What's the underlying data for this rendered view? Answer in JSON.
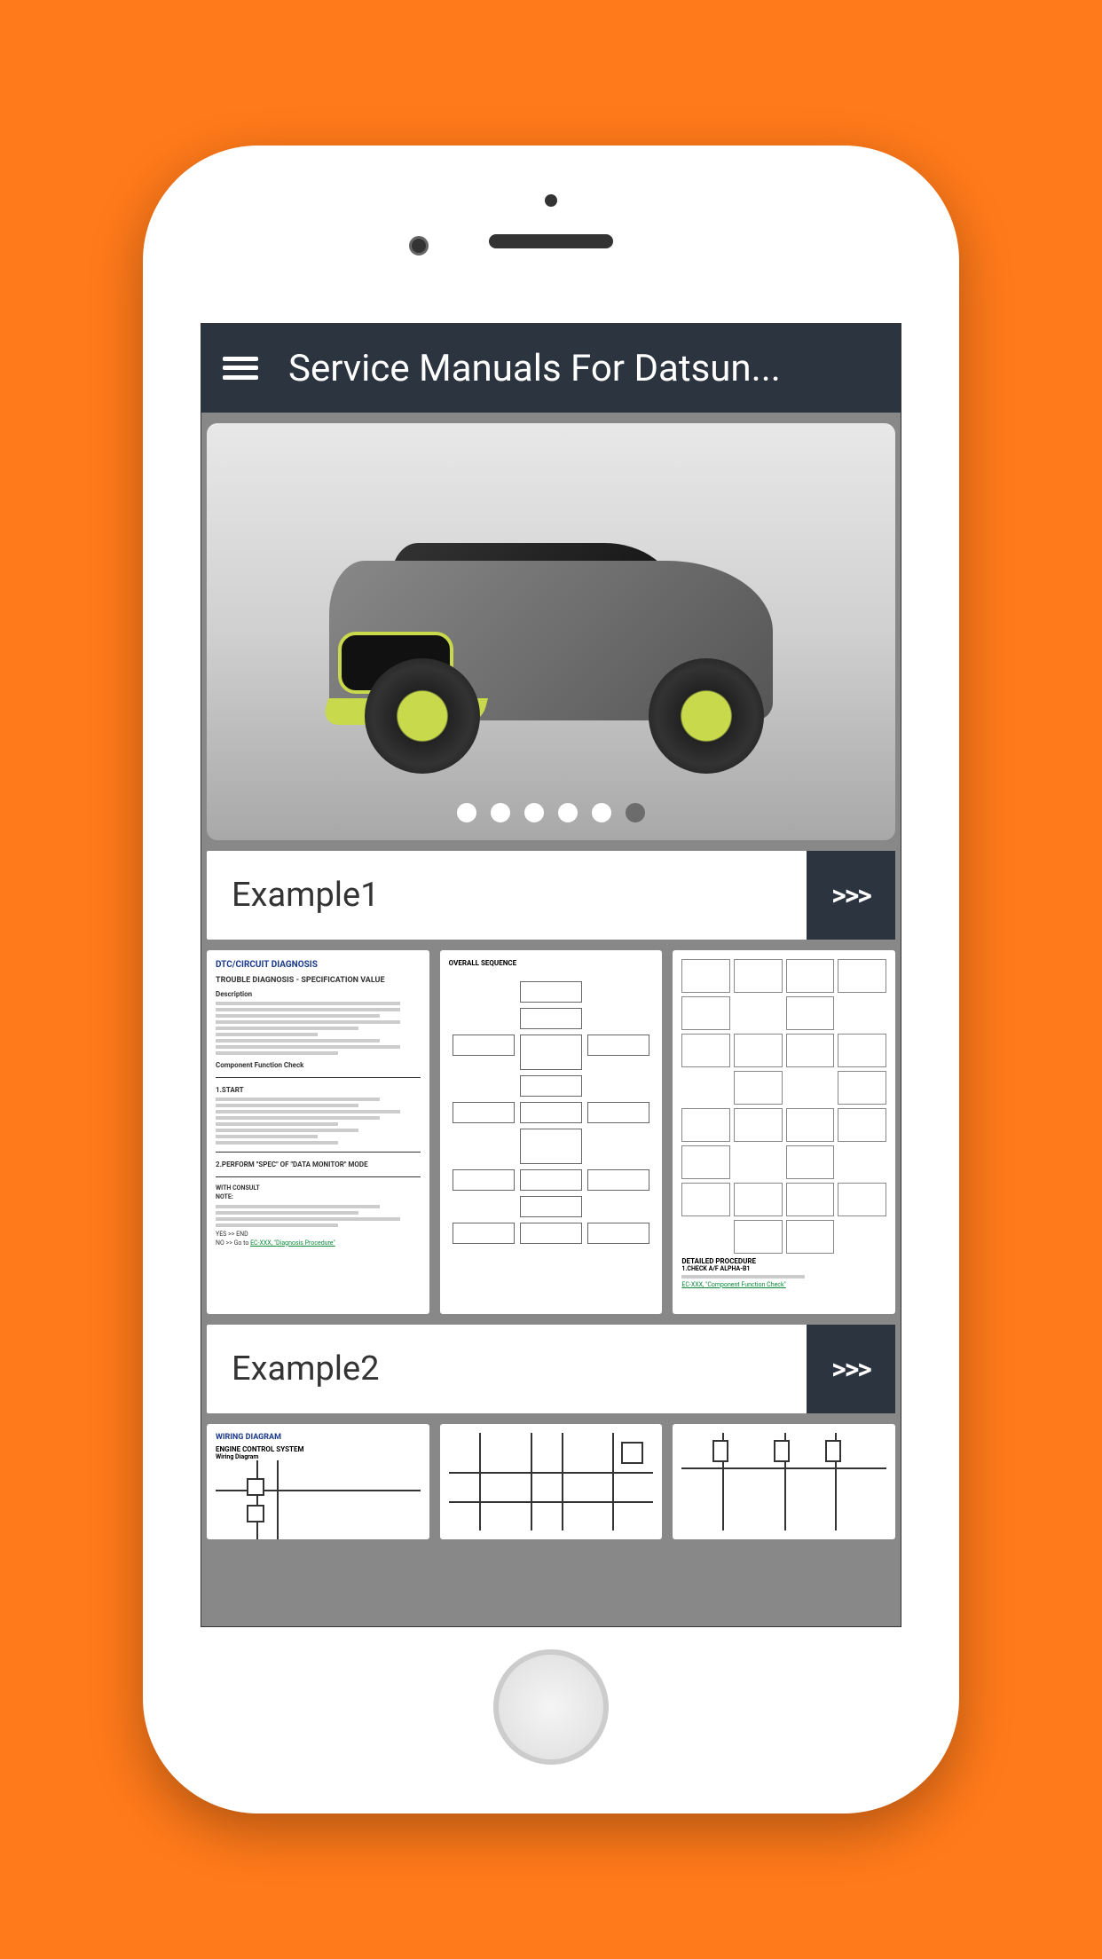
{
  "header": {
    "title": "Service Manuals For Datsun..."
  },
  "carousel": {
    "total_dots": 6,
    "active_index": 5
  },
  "sections": [
    {
      "title": "Example1",
      "more_label": ">>>",
      "thumbs": [
        {
          "type": "text-doc",
          "heading": "DTC/CIRCUIT DIAGNOSIS",
          "subheading": "TROUBLE DIAGNOSIS - SPECIFICATION VALUE",
          "section1": "Description",
          "section2": "Component Function Check",
          "step1": "1.START",
          "step2": "2.PERFORM \"SPEC\" OF \"DATA MONITOR\" MODE",
          "consult": "WITH CONSULT",
          "note": "NOTE:",
          "yes_end": "YES  >> END",
          "no_goto": "NO   >> Go to ",
          "link": "EC-XXX, \"Diagnosis Procedure\""
        },
        {
          "type": "flowchart",
          "heading": "OVERALL SEQUENCE"
        },
        {
          "type": "diagram",
          "footer1": "DETAILED PROCEDURE",
          "footer2": "1.CHECK A/F ALPHA-B1",
          "footer_link": "EC-XXX, \"Component Function Check\""
        }
      ]
    },
    {
      "title": "Example2",
      "more_label": ">>>",
      "thumbs": [
        {
          "type": "wiring",
          "heading": "WIRING DIAGRAM",
          "subheading": "ENGINE CONTROL SYSTEM",
          "label": "Wiring Diagram"
        },
        {
          "type": "wiring-partial"
        },
        {
          "type": "wiring-partial"
        }
      ]
    }
  ]
}
